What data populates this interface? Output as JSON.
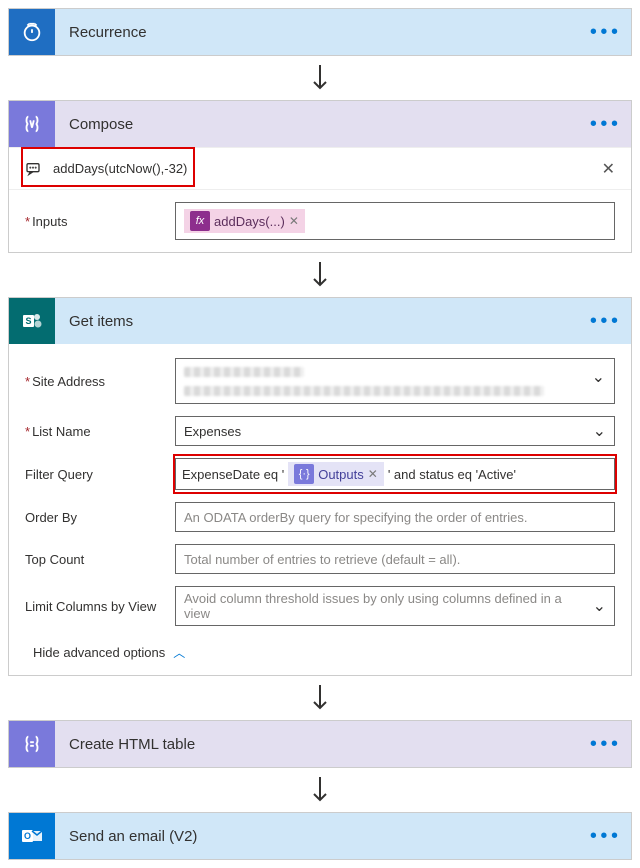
{
  "actions": {
    "recurrence": {
      "title": "Recurrence"
    },
    "compose": {
      "title": "Compose",
      "expression": "addDays(utcNow(),-32)",
      "inputs_label": "Inputs",
      "token_label": "addDays(...)"
    },
    "get_items": {
      "title": "Get items",
      "site_label": "Site Address",
      "list_label": "List Name",
      "list_value": "Expenses",
      "filter_label": "Filter Query",
      "filter_prefix": "ExpenseDate eq '",
      "filter_token": "Outputs",
      "filter_suffix": "' and status eq 'Active'",
      "orderby_label": "Order By",
      "orderby_placeholder": "An ODATA orderBy query for specifying the order of entries.",
      "topcount_label": "Top Count",
      "topcount_placeholder": "Total number of entries to retrieve (default = all).",
      "limit_label": "Limit Columns by View",
      "limit_placeholder": "Avoid column threshold issues by only using columns defined in a view",
      "hide_advanced": "Hide advanced options"
    },
    "create_table": {
      "title": "Create HTML table"
    },
    "send_email": {
      "title": "Send an email (V2)"
    }
  }
}
